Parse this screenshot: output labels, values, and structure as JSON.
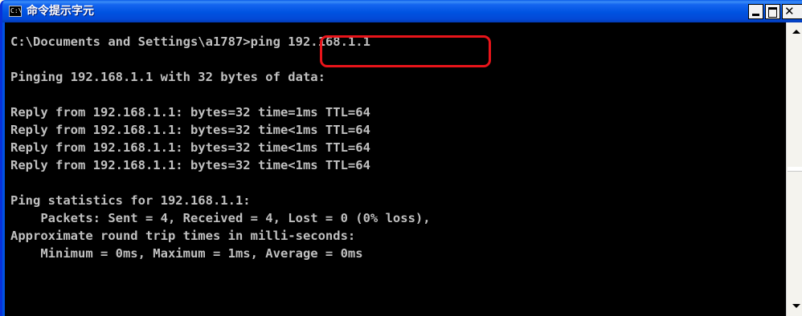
{
  "window": {
    "title": "命令提示字元",
    "icon_text": "C:\\"
  },
  "console": {
    "prompt": "C:\\Documents and Settings\\a1787>",
    "command": "ping 192.168.1.1",
    "lines": [
      "Pinging 192.168.1.1 with 32 bytes of data:",
      "",
      "Reply from 192.168.1.1: bytes=32 time=1ms TTL=64",
      "Reply from 192.168.1.1: bytes=32 time<1ms TTL=64",
      "Reply from 192.168.1.1: bytes=32 time<1ms TTL=64",
      "Reply from 192.168.1.1: bytes=32 time<1ms TTL=64",
      "",
      "Ping statistics for 192.168.1.1:",
      "    Packets: Sent = 4, Received = 4, Lost = 0 (0% loss),",
      "Approximate round trip times in milli-seconds:",
      "    Minimum = 0ms, Maximum = 1ms, Average = 0ms"
    ]
  },
  "icons": {
    "app": "console-app-icon",
    "minimize": "minimize-icon",
    "maximize": "maximize-icon",
    "close": "close-icon",
    "scroll_up": "scroll-up-arrow-icon",
    "scroll_down": "scroll-down-arrow-icon"
  },
  "colors": {
    "titlebar": "#0053e1",
    "console_bg": "#000000",
    "console_text": "#c0c0c0",
    "highlight": "#e8141a"
  }
}
